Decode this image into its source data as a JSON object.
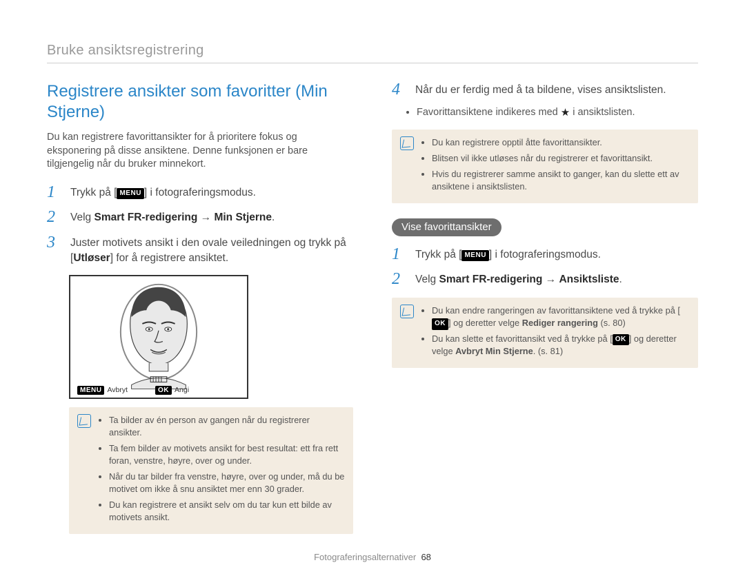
{
  "breadcrumb": "Bruke ansiktsregistrering",
  "left": {
    "title": "Registrere ansikter som favoritter (Min Stjerne)",
    "intro": "Du kan registrere favorittansikter for å prioritere fokus og eksponering på disse ansiktene. Denne funksjonen er bare tilgjengelig når du bruker minnekort.",
    "steps": [
      {
        "num": "1",
        "pre": "Trykk på [",
        "btn": "MENU",
        "post": "] i fotograferingsmodus."
      },
      {
        "num": "2",
        "textA": "Velg ",
        "bold1": "Smart FR-redigering",
        "arrow": " → ",
        "bold2": "Min Stjerne",
        "textB": "."
      },
      {
        "num": "3",
        "line1a": "Juster motivets ansikt i den ovale veiledningen og trykk på [",
        "line1Bold": "Utløser",
        "line1b": "] for å registrere ansiktet."
      }
    ],
    "illus": {
      "cancel_btn": "MENU",
      "cancel": "Avbryt",
      "ok_btn": "OK",
      "ok": "Angi"
    },
    "note": [
      "Ta bilder av én person av gangen når du registrerer ansikter.",
      "Ta fem bilder av motivets ansikt for best resultat: ett fra rett foran, venstre, høyre, over og under.",
      "Når du tar bilder fra venstre, høyre, over og under, må du be motivet om ikke å snu ansiktet mer enn 30 grader.",
      "Du kan registrere et ansikt selv om du tar kun ett bilde av motivets ansikt."
    ]
  },
  "right": {
    "step4": {
      "num": "4",
      "text": "Når du er ferdig med å ta bildene, vises ansiktslisten."
    },
    "sub": {
      "pre": "Favorittansiktene indikeres med ",
      "post": " i ansiktslisten."
    },
    "note1": [
      "Du kan registrere opptil åtte favorittansikter.",
      "Blitsen vil ikke utløses når du registrerer et favorittansikt.",
      "Hvis du registrerer samme ansikt to ganger, kan du slette ett av ansiktene i ansiktslisten."
    ],
    "pill": "Vise favorittansikter",
    "steps2": [
      {
        "num": "1",
        "pre": "Trykk på [",
        "btn": "MENU",
        "post": "] i fotograferingsmodus."
      },
      {
        "num": "2",
        "textA": "Velg ",
        "bold1": "Smart FR-redigering",
        "arrow": " → ",
        "bold2": "Ansiktsliste",
        "textB": "."
      }
    ],
    "note2": {
      "l1a": "Du kan endre rangeringen av favorittansiktene ved å trykke på [",
      "l1btn": "OK",
      "l1b": "] og deretter velge ",
      "l1bold": "Rediger rangering",
      "l1c": " (s. 80)",
      "l2a": "Du kan slette et favorittansikt ved å trykke på [",
      "l2btn": "OK",
      "l2b": "] og deretter velge ",
      "l2bold": "Avbryt Min Stjerne",
      "l2c": ". (s. 81)"
    }
  },
  "footer": {
    "section": "Fotograferingsalternativer",
    "page": "68"
  }
}
